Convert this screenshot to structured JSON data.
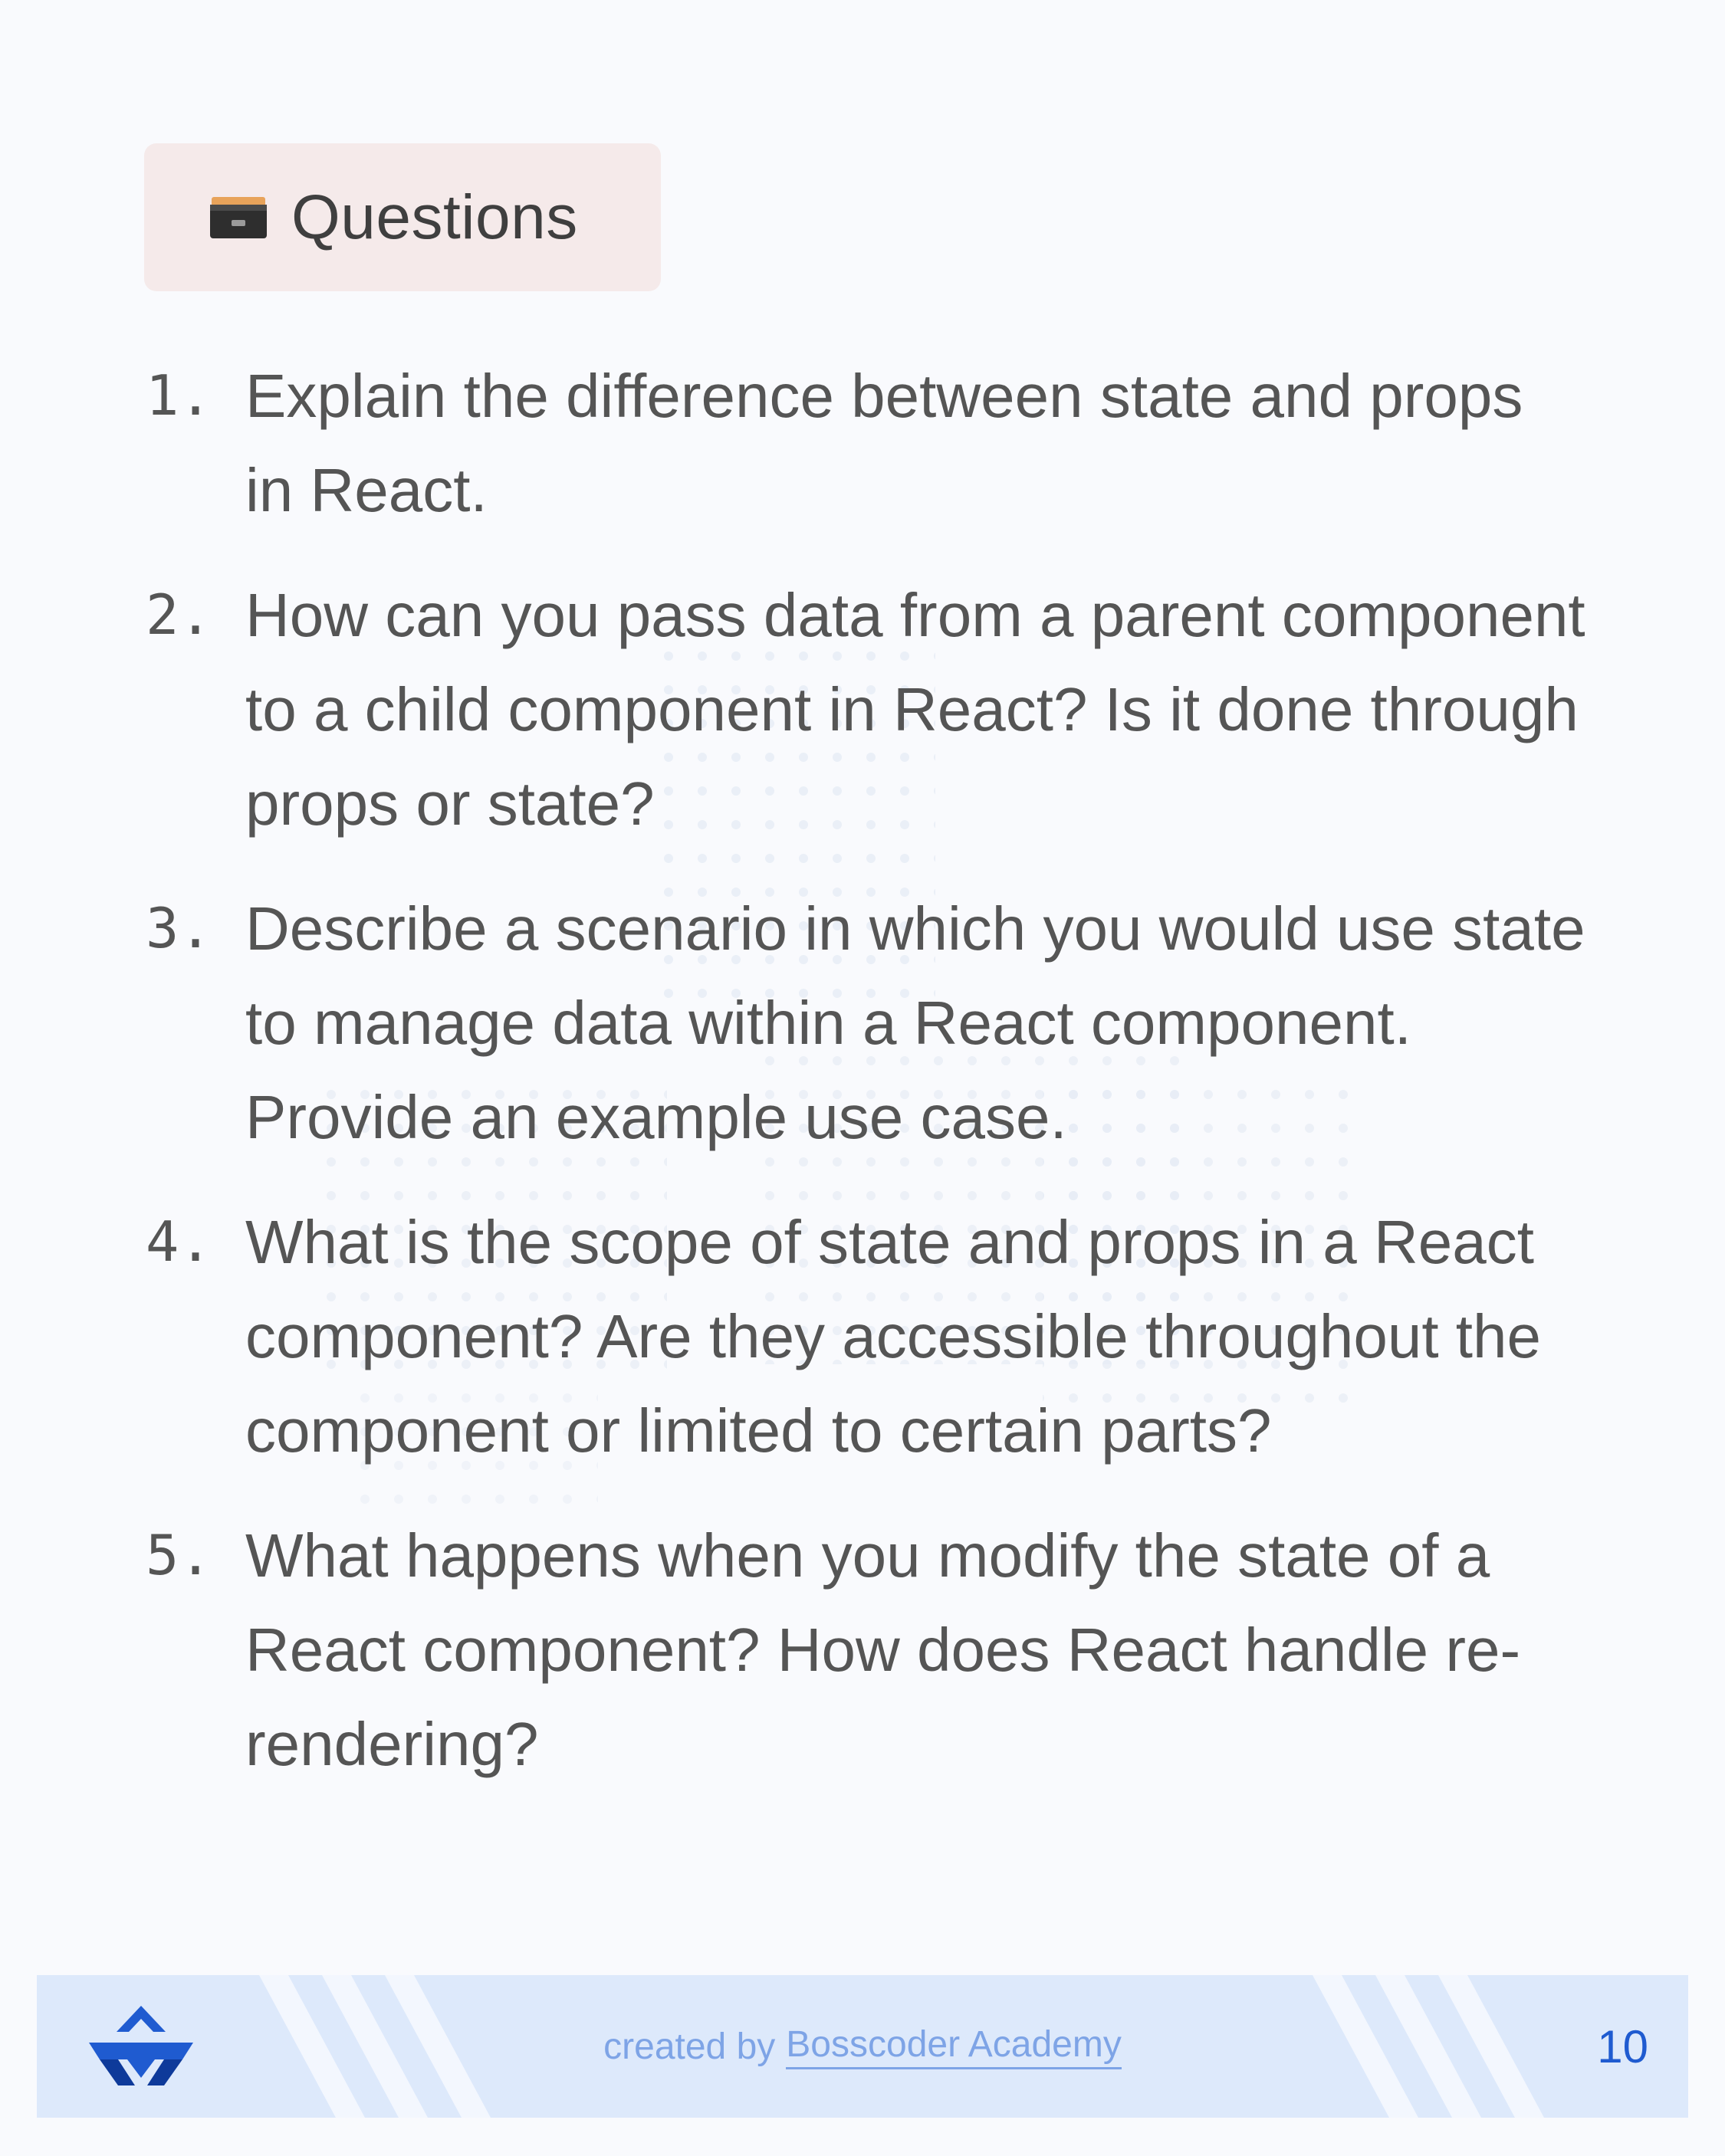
{
  "header": {
    "icon": "card-file-box-icon",
    "title": "Questions"
  },
  "questions": [
    {
      "number": "1.",
      "text": "Explain the difference between state and props in React."
    },
    {
      "number": "2.",
      "text": "How can you pass data from a parent component to a child component in React? Is it done through props or state?"
    },
    {
      "number": "3.",
      "text": "Describe a scenario in which you would use state to manage data within a React component. Provide an example use case."
    },
    {
      "number": "4.",
      "text": "What is the scope of state and props in a React component? Are they accessible throughout the component or limited to certain parts?"
    },
    {
      "number": "5.",
      "text": "What happens when you modify the state of a React component? How does React handle re-rendering?"
    }
  ],
  "footer": {
    "logo": "bosscoder-logo",
    "credit_prefix": "created by",
    "credit_link": "Bosscoder Academy",
    "page_number": "10"
  },
  "colors": {
    "background": "#f9fafd",
    "chip_background": "#f5eaea",
    "footer_background": "#dde9fb",
    "text": "#555555",
    "accent": "#1f5bd0"
  }
}
